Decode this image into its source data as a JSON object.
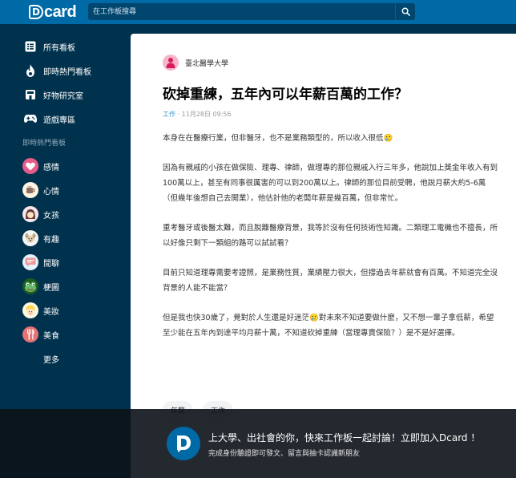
{
  "header": {
    "logo_text": "card",
    "logo_letter": "D",
    "search_placeholder": "在工作板搜尋"
  },
  "sidebar": {
    "main_items": [
      {
        "label": "所有看板",
        "icon": "list-icon"
      },
      {
        "label": "即時熱門看板",
        "icon": "flame-icon"
      },
      {
        "label": "好物研究室",
        "icon": "store-icon"
      },
      {
        "label": "遊戲專區",
        "icon": "gamepad-icon"
      }
    ],
    "section_heading": "即時熱門看板",
    "forums": [
      {
        "label": "感情",
        "icon": "heart-icon"
      },
      {
        "label": "心情",
        "icon": "cup-icon"
      },
      {
        "label": "女孩",
        "icon": "girl-icon"
      },
      {
        "label": "有趣",
        "icon": "dog-icon"
      },
      {
        "label": "閒聊",
        "icon": "chat-icon"
      },
      {
        "label": "梗圖",
        "icon": "frog-icon"
      },
      {
        "label": "美妝",
        "icon": "face-icon"
      },
      {
        "label": "美食",
        "icon": "fork-icon"
      }
    ],
    "more_label": "更多"
  },
  "post": {
    "school": "臺北醫學大學",
    "title": "砍掉重練，五年內可以年薪百萬的工作？",
    "forum": "工作",
    "meta_separator": "·",
    "date": "11月28日 09:56",
    "paragraphs": [
      "本身在在醫療行業，但非醫牙，也不是業務類型的，所以收入很低🥲",
      "因為有親戚的小孩在做保險、理專、律師，做理專的那位親戚入行三年多，他說加上獎金年收入有到100萬以上，甚至有同事很厲害的可以到200萬以上。律師的那位目前受聘，他說月薪大約5-6萬（但幾年後想自己去開業），他估計他的老闆年薪是幾百萬，但非常忙。",
      "重考醫牙或後醫太難，而且脫離醫療背景，我等於沒有任何技術性知識。二類理工電機也不擅長，所以好像只剩下一類組的路可以試試看？",
      "目前只知道理專需要考證照，是業務性質，業績壓力很大，但撐過去年薪就會有百萬。不知道完全沒背景的人能不能當？",
      "但是我也快30歲了，覺對於人生還是好迷茫🥲對未來不知道要做什麼，又不想一輩子拿低薪，希望至少能在五年內到達平均月薪十萬，不知道砍掉重練（當理專賣保險？）是不是好選擇。"
    ],
    "tags": [
      "年薪",
      "工作"
    ]
  },
  "banner": {
    "title": "上大學、出社會的你，快來工作板一起討論！立即加入Dcard ！",
    "subtitle": "完成身份驗證即可發文、留言與抽卡認識新朋友"
  },
  "colors": {
    "topbar": "#006aa6",
    "background": "#00324e",
    "search": "#00466e",
    "link": "#3397cf"
  }
}
